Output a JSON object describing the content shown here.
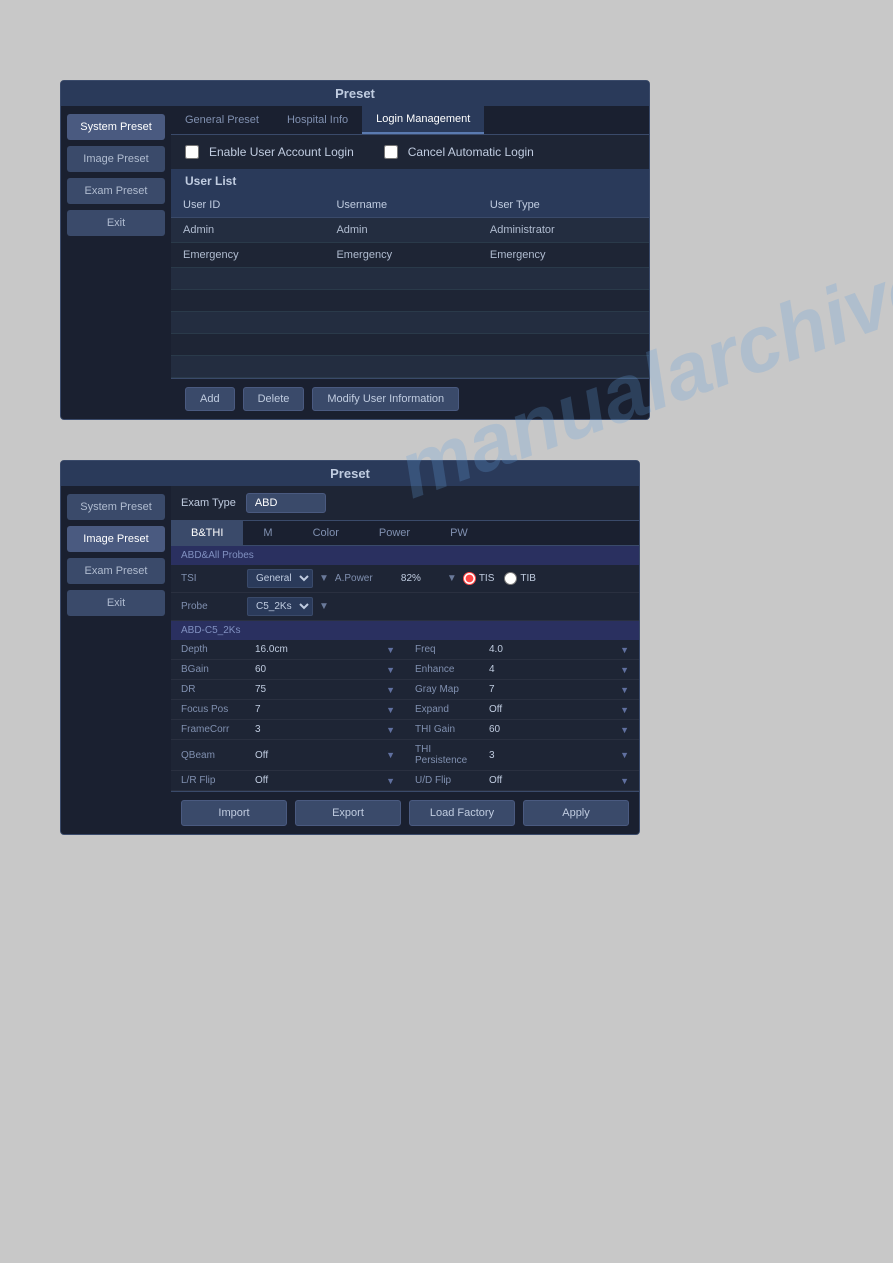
{
  "watermark": "manualarchive.com",
  "dialog1": {
    "title": "Preset",
    "sidebar": {
      "buttons": [
        {
          "label": "System Preset",
          "active": true
        },
        {
          "label": "Image Preset",
          "active": false
        },
        {
          "label": "Exam Preset",
          "active": false
        },
        {
          "label": "Exit",
          "active": false
        }
      ]
    },
    "tabs": [
      {
        "label": "General Preset",
        "active": false
      },
      {
        "label": "Hospital Info",
        "active": false
      },
      {
        "label": "Login Management",
        "active": true
      }
    ],
    "enable_user_label": "Enable User Account Login",
    "cancel_auto_label": "Cancel Automatic Login",
    "user_list_label": "User List",
    "table": {
      "columns": [
        "User ID",
        "Username",
        "User Type"
      ],
      "rows": [
        {
          "id": "Admin",
          "username": "Admin",
          "type": "Administrator"
        },
        {
          "id": "Emergency",
          "username": "Emergency",
          "type": "Emergency"
        }
      ]
    },
    "buttons": {
      "add": "Add",
      "delete": "Delete",
      "modify": "Modify User Information"
    }
  },
  "dialog2": {
    "title": "Preset",
    "sidebar": {
      "buttons": [
        {
          "label": "System Preset",
          "active": false
        },
        {
          "label": "Image Preset",
          "active": true
        },
        {
          "label": "Exam Preset",
          "active": false
        },
        {
          "label": "Exit",
          "active": false
        }
      ]
    },
    "exam_type_label": "Exam Type",
    "exam_type_value": "ABD",
    "tabs": [
      {
        "label": "B&THI",
        "active": true
      },
      {
        "label": "M",
        "active": false
      },
      {
        "label": "Color",
        "active": false
      },
      {
        "label": "Power",
        "active": false
      },
      {
        "label": "PW",
        "active": false
      }
    ],
    "section1": "ABD&All Probes",
    "tsi": {
      "label": "TSI",
      "value": "General",
      "a_power_label": "A.Power",
      "a_power_value": "82%",
      "tis_label": "TIS",
      "tib_label": "TIB"
    },
    "probe": {
      "label": "Probe",
      "value": "C5_2Ks"
    },
    "section2": "ABD-C5_2Ks",
    "params": [
      {
        "label": "Depth",
        "value": "16.0cm",
        "col": 1
      },
      {
        "label": "Freq",
        "value": "4.0",
        "col": 2
      },
      {
        "label": "BGain",
        "value": "60",
        "col": 1
      },
      {
        "label": "Enhance",
        "value": "4",
        "col": 2
      },
      {
        "label": "DR",
        "value": "75",
        "col": 1
      },
      {
        "label": "Gray Map",
        "value": "7",
        "col": 2
      },
      {
        "label": "Focus Pos",
        "value": "7",
        "col": 1
      },
      {
        "label": "Expand",
        "value": "Off",
        "col": 2
      },
      {
        "label": "FrameCorr",
        "value": "3",
        "col": 1
      },
      {
        "label": "THI Gain",
        "value": "60",
        "col": 2
      },
      {
        "label": "QBeam",
        "value": "Off",
        "col": 1
      },
      {
        "label": "THI Persistence",
        "value": "3",
        "col": 2
      },
      {
        "label": "L/R Flip",
        "value": "Off",
        "col": 1
      },
      {
        "label": "U/D Flip",
        "value": "Off",
        "col": 2
      }
    ],
    "buttons": {
      "import": "Import",
      "export": "Export",
      "load_factory": "Load Factory",
      "apply": "Apply"
    }
  }
}
